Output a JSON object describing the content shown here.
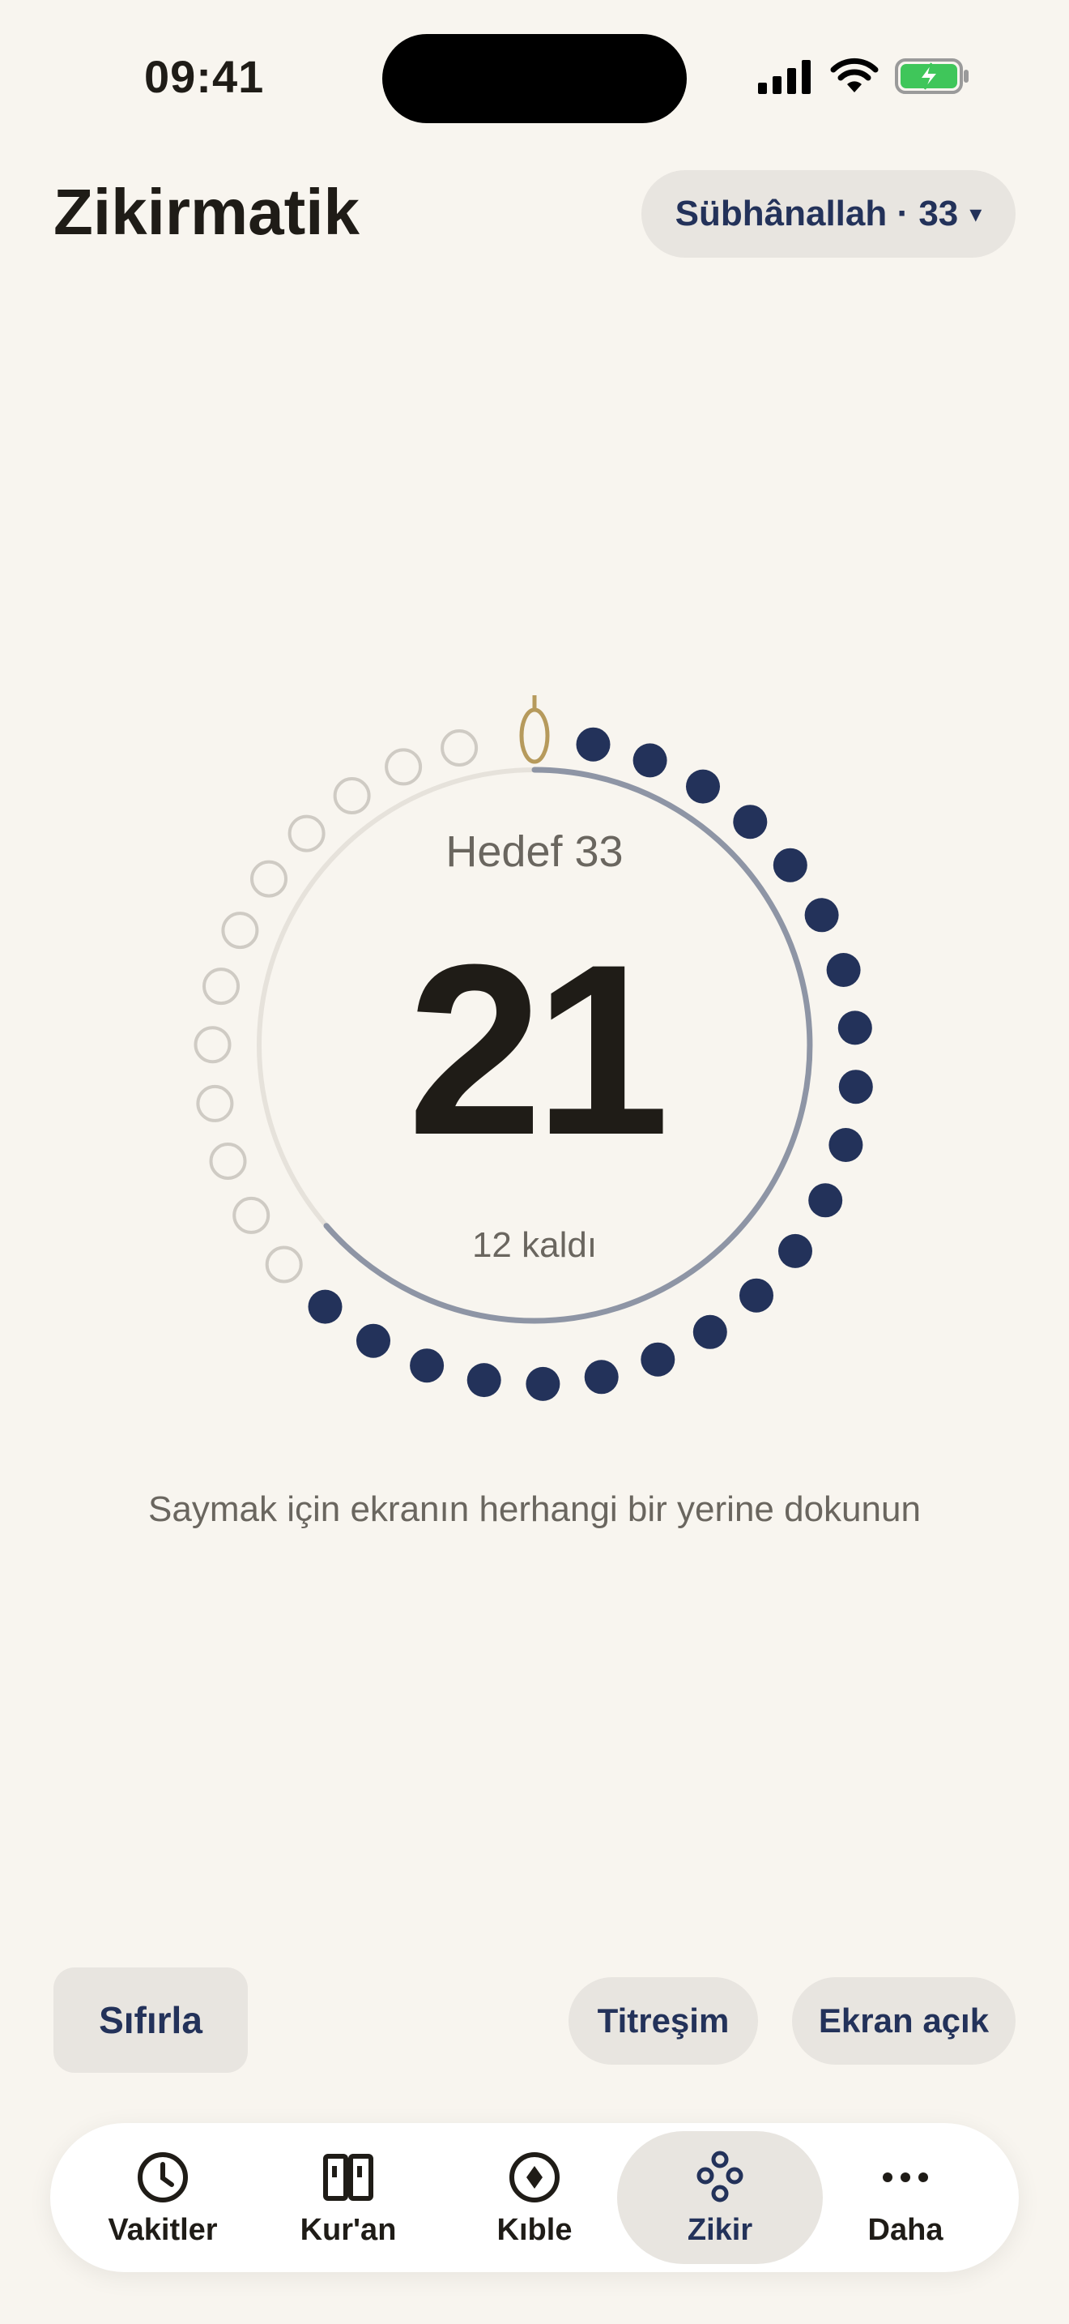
{
  "status_bar": {
    "time": "09:41"
  },
  "header": {
    "title": "Zikirmatik",
    "dhikr_selector": "Sübhânallah · 33",
    "caret": "▾"
  },
  "counter": {
    "goal_text": "Hedef 33",
    "count": "21",
    "remaining_text": "12 kaldı",
    "target": 33,
    "completed": 21
  },
  "hint": "Saymak için ekranın herhangi bir yerine dokunun",
  "controls": {
    "reset": "Sıfırla",
    "vibration": "Titreşim",
    "screen_on": "Ekran açık"
  },
  "tabs": [
    {
      "label": "Vakitler",
      "icon": "clock-icon"
    },
    {
      "label": "Kur'an",
      "icon": "book-icon"
    },
    {
      "label": "Kıble",
      "icon": "compass-icon"
    },
    {
      "label": "Zikir",
      "icon": "beads-icon",
      "active": true
    },
    {
      "label": "Daha",
      "icon": "more-icon"
    }
  ],
  "colors": {
    "background": "#F8F5EF",
    "accent": "#23325A",
    "bead_empty": "#CFCBC4",
    "imam_bead": "#B69A5C",
    "chip": "#E8E5E0"
  }
}
